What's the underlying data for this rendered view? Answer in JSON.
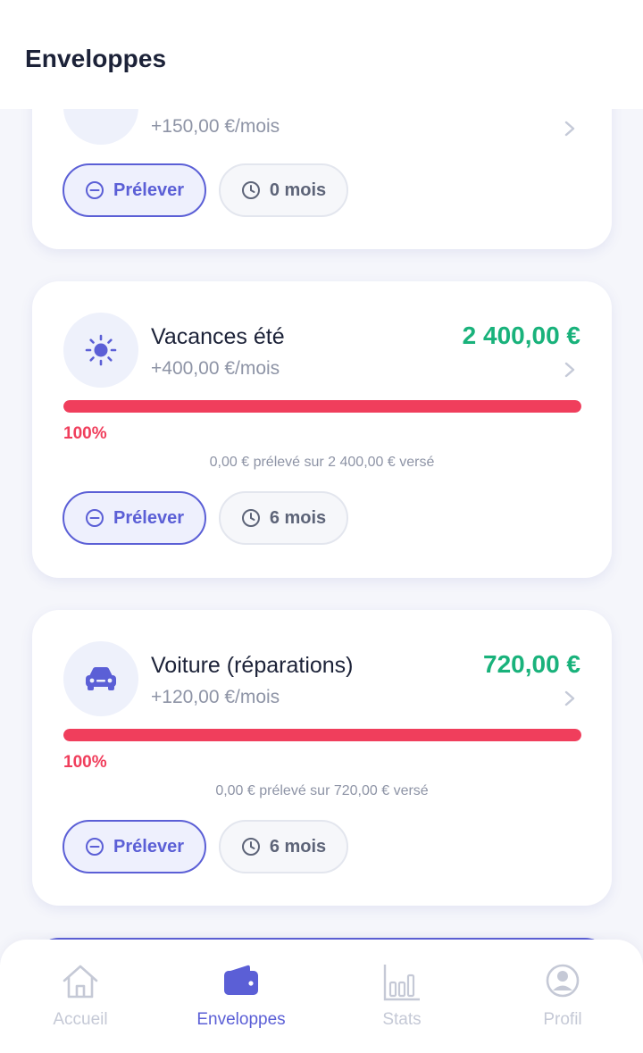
{
  "header": {
    "title": "Enveloppes"
  },
  "envelopes": [
    {
      "name": "",
      "rate": "+150,00 €/mois",
      "amount": "",
      "withdraw_label": "Prélever",
      "months_label": "0 mois"
    },
    {
      "name": "Vacances été",
      "rate": "+400,00 €/mois",
      "amount": "2 400,00 €",
      "progress_percent": 100,
      "progress_label": "100%",
      "summary": "0,00 € prélevé sur 2 400,00 € versé",
      "withdraw_label": "Prélever",
      "months_label": "6 mois",
      "icon": "sun-icon"
    },
    {
      "name": "Voiture (réparations)",
      "rate": "+120,00 €/mois",
      "amount": "720,00 €",
      "progress_percent": 100,
      "progress_label": "100%",
      "summary": "0,00 € prélevé sur 720,00 € versé",
      "withdraw_label": "Prélever",
      "months_label": "6 mois",
      "icon": "car-icon"
    }
  ],
  "tabs": [
    {
      "label": "Accueil",
      "icon": "home-icon",
      "active": false
    },
    {
      "label": "Enveloppes",
      "icon": "wallet-icon",
      "active": true
    },
    {
      "label": "Stats",
      "icon": "bar-chart-icon",
      "active": false
    },
    {
      "label": "Profil",
      "icon": "user-icon",
      "active": false
    }
  ],
  "colors": {
    "accent": "#5b5fd6",
    "amount": "#19b27b",
    "progress": "#f03e5c",
    "muted": "#8e94a6",
    "inactive_tab": "#c5c9d6"
  }
}
